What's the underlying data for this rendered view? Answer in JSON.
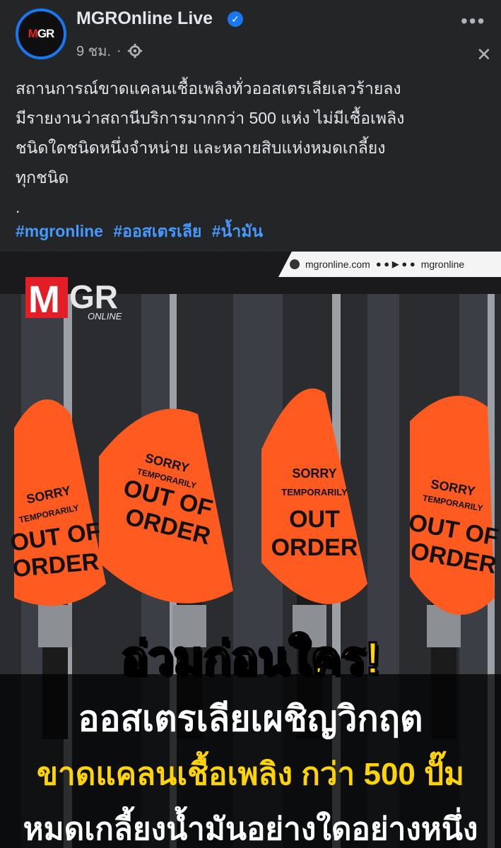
{
  "post": {
    "page_name": "MGROnline Live",
    "time": "9 ชม.",
    "separator": "·",
    "text_lines": [
      "สถานการณ์ขาดแคลนเชื้อเพลิงทั่วออสเตรเลียเลวร้ายลง",
      "มีรายงานว่าสถานีบริการมากกว่า 500 แห่ง ไม่มีเชื้อเพลิง",
      "ชนิดใดชนิดหนึ่งจำหน่าย และหลายสิบแห่งหมดเกลี้ยง",
      "ทุกชนิด",
      "."
    ],
    "hashtags": [
      "#mgronline",
      "#ออสเตรเลีย",
      "#น้ำมัน"
    ]
  },
  "image": {
    "banner_site": "mgronline.com",
    "banner_handle": "mgronline",
    "logo_text": "MGR",
    "logo_sub": "ONLINE",
    "flag_sorry": "SORRY",
    "flag_temp": "TEMPORARILY",
    "flag_out": "OUT OF",
    "flag_order": "ORDER",
    "headline_1": "อ่วมก่อนใคร!",
    "headline_2": "ออสเตรเลียเผชิญวิกฤต",
    "headline_3": "ขาดแคลนเชื้อเพลิง กว่า 500 ปั๊ม",
    "headline_4": "หมดเกลี้ยงน้ำมันอย่างใดอย่างหนึ่ง"
  },
  "colors": {
    "accent": "#1877f2",
    "hashtag": "#4599ff",
    "headline_yellow": "#ffd400",
    "flag_orange": "#ff5a1f"
  },
  "icons": [
    "verified-badge-icon",
    "globe-privacy-icon",
    "more-options-icon",
    "close-icon"
  ]
}
